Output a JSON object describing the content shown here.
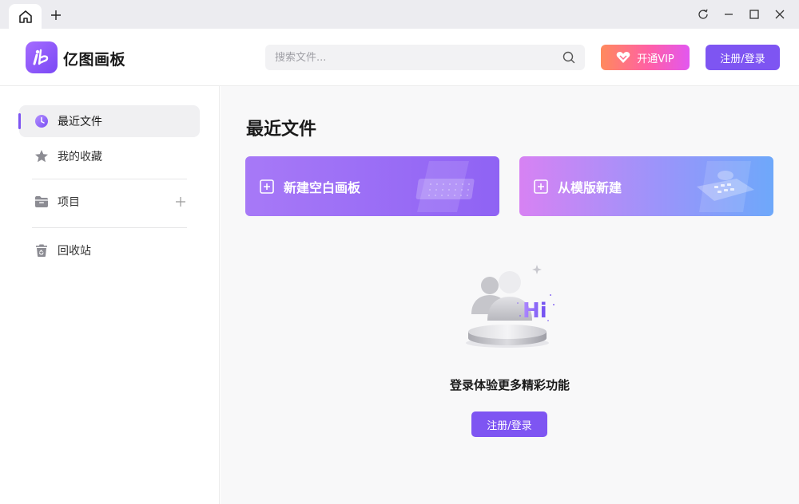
{
  "titlebar": {
    "home_icon": "home-icon",
    "new_tab_icon": "plus-icon",
    "controls": [
      "refresh-icon",
      "minimize-icon",
      "maximize-icon",
      "close-icon"
    ]
  },
  "header": {
    "app_name": "亿图画板",
    "search_placeholder": "搜索文件...",
    "vip_label": "开通VIP",
    "login_label": "注册/登录"
  },
  "sidebar": {
    "items": [
      {
        "label": "最近文件",
        "icon": "clock-icon",
        "active": true
      },
      {
        "label": "我的收藏",
        "icon": "star-icon",
        "active": false
      },
      {
        "label": "项目",
        "icon": "folder-icon",
        "active": false
      },
      {
        "label": "回收站",
        "icon": "trash-icon",
        "active": false
      }
    ]
  },
  "main": {
    "title": "最近文件",
    "cards": [
      {
        "label": "新建空白画板",
        "icon": "plus-square-icon"
      },
      {
        "label": "从模版新建",
        "icon": "plus-square-icon"
      }
    ],
    "empty": {
      "illustration_text": "Hi",
      "message": "登录体验更多精彩功能",
      "login_label": "注册/登录"
    }
  },
  "colors": {
    "accent": "#7e55f2",
    "vip_gradient_start": "#ff8a5c",
    "vip_gradient_end": "#e257f0"
  }
}
